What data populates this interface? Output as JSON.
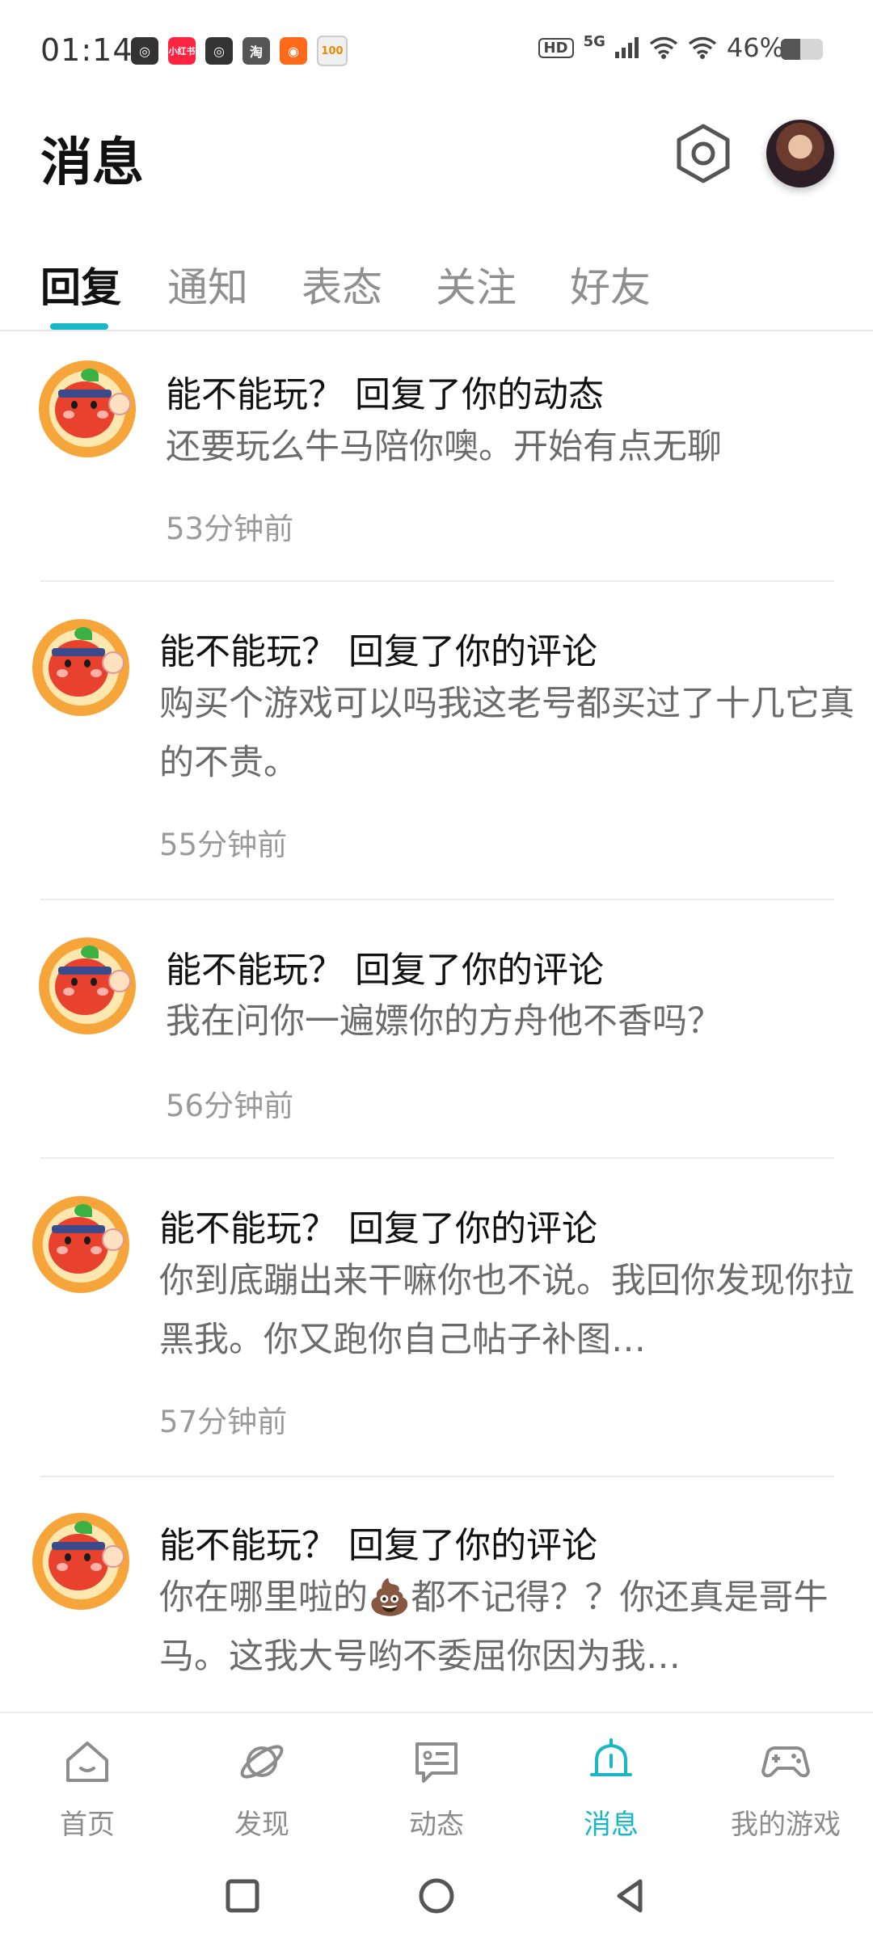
{
  "status_bar": {
    "time": "01:14",
    "apps": [
      {
        "icon": "netease-icon",
        "text": "◎",
        "color": "#ffffff"
      },
      {
        "icon": "xiaohongshu-icon",
        "text": "小红书",
        "color": "#ff2442"
      },
      {
        "icon": "netease-music-icon",
        "text": "◎",
        "color": "#ffffff"
      },
      {
        "icon": "taobao-icon",
        "text": "淘",
        "color": "#555555"
      },
      {
        "icon": "kuaishou-icon",
        "text": "◉",
        "color": "#ff6a1a"
      },
      {
        "icon": "app-100-icon",
        "text": "100",
        "color": "#f0f0f0"
      }
    ],
    "hd": "HD",
    "network": "5G",
    "battery_text": "46%",
    "battery_level": 0.46
  },
  "header": {
    "title": "消息"
  },
  "tabs": [
    "回复",
    "通知",
    "表态",
    "关注",
    "好友"
  ],
  "active_tab": 0,
  "messages": [
    {
      "title": "能不能玩？ 回复了你的动态",
      "body": "还要玩么牛马陪你噢。开始有点无聊",
      "time": "53分钟前"
    },
    {
      "title": "能不能玩？ 回复了你的评论",
      "body": "购买个游戏可以吗我这老号都买过了十几它真的不贵。",
      "time": "55分钟前"
    },
    {
      "title": "能不能玩？ 回复了你的评论",
      "body": "我在问你一遍嫖你的方舟他不香吗？",
      "time": "56分钟前"
    },
    {
      "title": "能不能玩？ 回复了你的评论",
      "body": "你到底蹦出来干嘛你也不说。我回你发现你拉黑我。你又跑你自己帖子补图…",
      "time": "57分钟前"
    },
    {
      "title": "能不能玩？ 回复了你的评论",
      "body": "你在哪里啦的💩都不记得？？你还真是哥牛马。这我大号哟不委屈你因为我…",
      "time": ""
    }
  ],
  "bottom_nav": [
    {
      "label": "首页",
      "icon": "home-icon"
    },
    {
      "label": "发现",
      "icon": "planet-icon"
    },
    {
      "label": "动态",
      "icon": "message-card-icon"
    },
    {
      "label": "消息",
      "icon": "bell-icon"
    },
    {
      "label": "我的游戏",
      "icon": "gamepad-icon"
    }
  ],
  "active_nav": 3,
  "colors": {
    "accent": "#17b8c4",
    "text_primary": "#111111",
    "text_secondary": "#6b6b6b",
    "text_muted": "#9a9a9a"
  }
}
